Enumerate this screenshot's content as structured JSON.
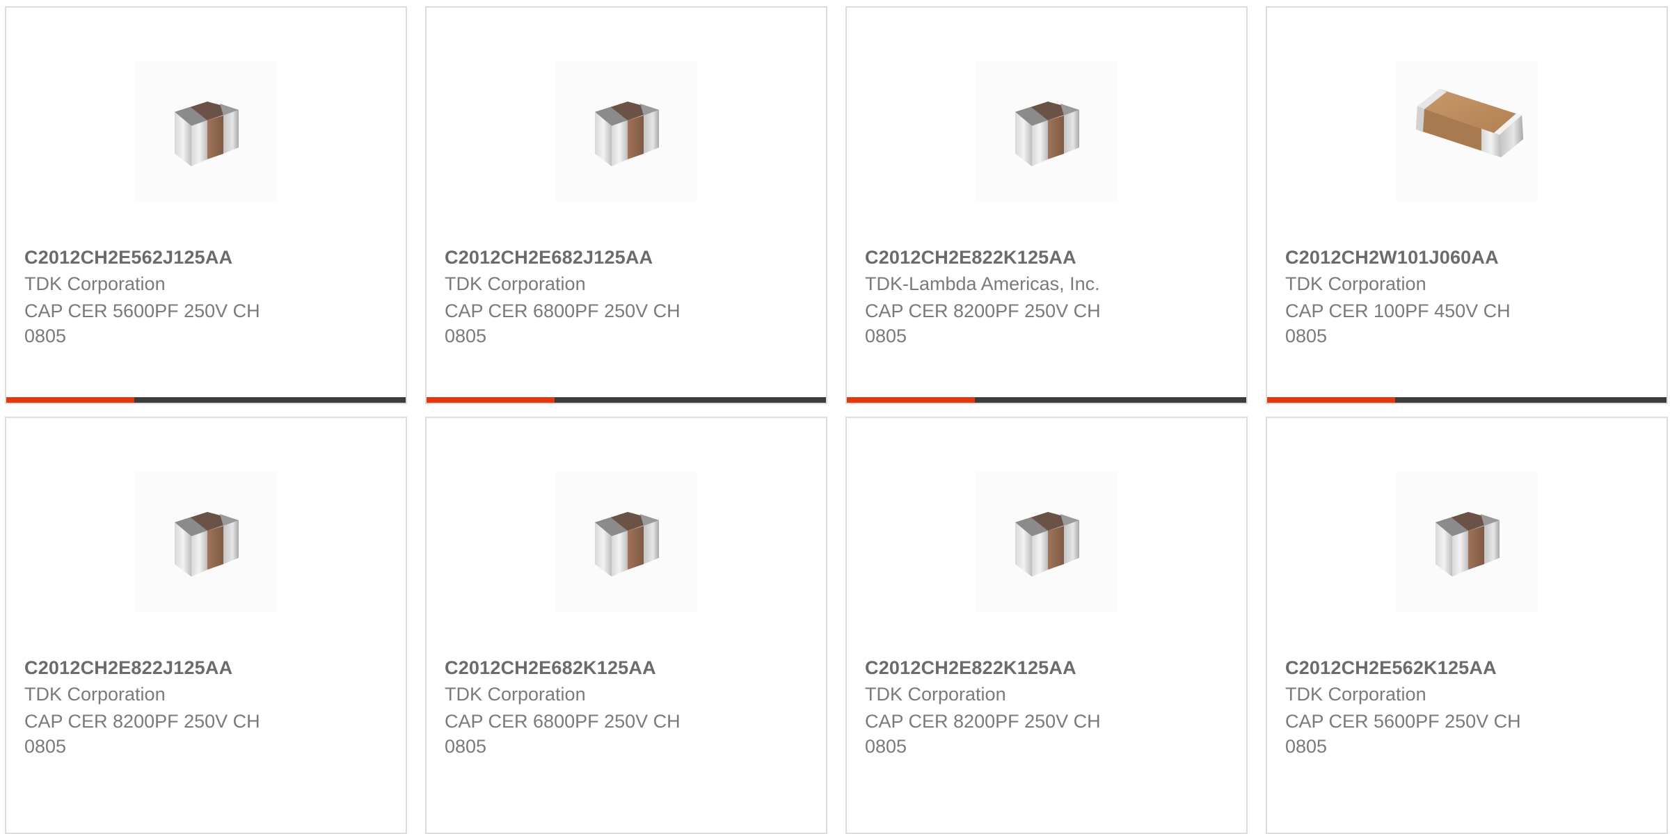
{
  "products": [
    {
      "part": "C2012CH2E562J125AA",
      "manufacturer": "TDK Corporation",
      "description": "CAP CER 5600PF 250V CH 0805",
      "image": "capacitor-0805-icon"
    },
    {
      "part": "C2012CH2E682J125AA",
      "manufacturer": "TDK Corporation",
      "description": "CAP CER 6800PF 250V CH 0805",
      "image": "capacitor-0805-icon"
    },
    {
      "part": "C2012CH2E822K125AA",
      "manufacturer": "TDK-Lambda Americas, Inc.",
      "description": "CAP CER 8200PF 250V CH 0805",
      "image": "capacitor-0805-icon"
    },
    {
      "part": "C2012CH2W101J060AA",
      "manufacturer": "TDK Corporation",
      "description": "CAP CER 100PF 450V CH 0805",
      "image": "capacitor-flat-icon"
    },
    {
      "part": "C2012CH2E822J125AA",
      "manufacturer": "TDK Corporation",
      "description": "CAP CER 8200PF 250V CH 0805",
      "image": "capacitor-0805-icon"
    },
    {
      "part": "C2012CH2E682K125AA",
      "manufacturer": "TDK Corporation",
      "description": "CAP CER 6800PF 250V CH 0805",
      "image": "capacitor-0805-icon"
    },
    {
      "part": "C2012CH2E822K125AA",
      "manufacturer": "TDK Corporation",
      "description": "CAP CER 8200PF 250V CH 0805",
      "image": "capacitor-0805-icon"
    },
    {
      "part": "C2012CH2E562K125AA",
      "manufacturer": "TDK Corporation",
      "description": "CAP CER 5600PF 250V CH 0805",
      "image": "capacitor-0805-icon"
    }
  ],
  "progress_fraction": 0.32,
  "colors": {
    "accent": "#e8360c",
    "bar": "#3c3c3c",
    "border": "#dcdcdc",
    "part_text": "#6b6b6b",
    "body_text": "#7a7a7a"
  }
}
